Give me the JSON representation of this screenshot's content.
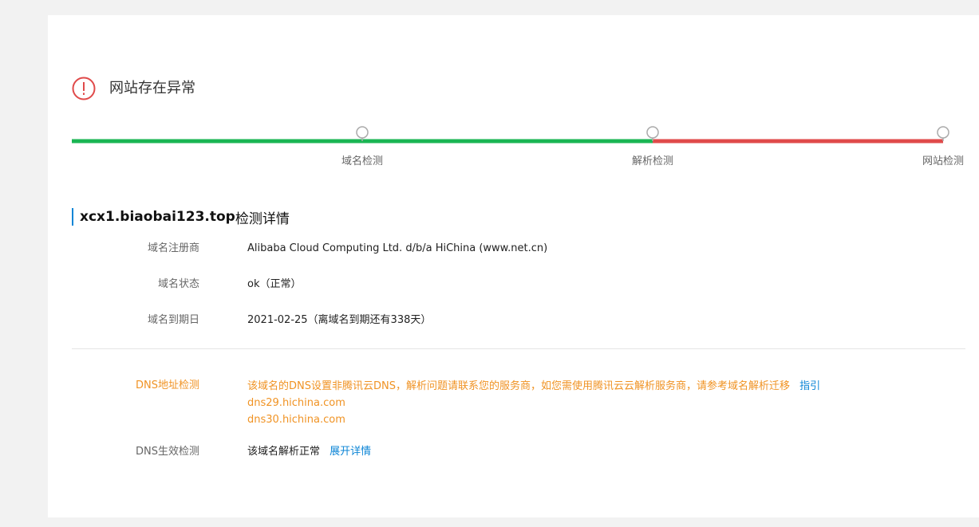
{
  "status": {
    "title": "网站存在异常",
    "icon": "warning-circle-icon",
    "icon_color": "#e04a4a"
  },
  "progress": {
    "steps": [
      {
        "label": "域名检测",
        "state": "ok"
      },
      {
        "label": "解析检测",
        "state": "ok"
      },
      {
        "label": "网站检测",
        "state": "error"
      }
    ],
    "colors": {
      "ok": "#1ab553",
      "error": "#e04a4a",
      "node": "#aaaaaa"
    }
  },
  "section": {
    "domain": "xcx1.biaobai123.top",
    "suffix": "检测详情"
  },
  "info": {
    "registrar_label": "域名注册商",
    "registrar_value": "Alibaba Cloud Computing Ltd. d/b/a HiChina (www.net.cn)",
    "status_label": "域名状态",
    "status_value": "ok（正常）",
    "expiry_label": "域名到期日",
    "expiry_value": "2021-02-25（离域名到期还有338天）"
  },
  "dns": {
    "address_label": "DNS地址检测",
    "address_message": "该域名的DNS设置非腾讯云DNS，解析问题请联系您的服务商，如您需使用腾讯云云解析服务商，请参考域名解析迁移",
    "guide_link": "指引",
    "servers": [
      "dns29.hichina.com",
      "dns30.hichina.com"
    ],
    "effect_label": "DNS生效检测",
    "effect_value": "该域名解析正常",
    "expand_link": "展开详情"
  }
}
